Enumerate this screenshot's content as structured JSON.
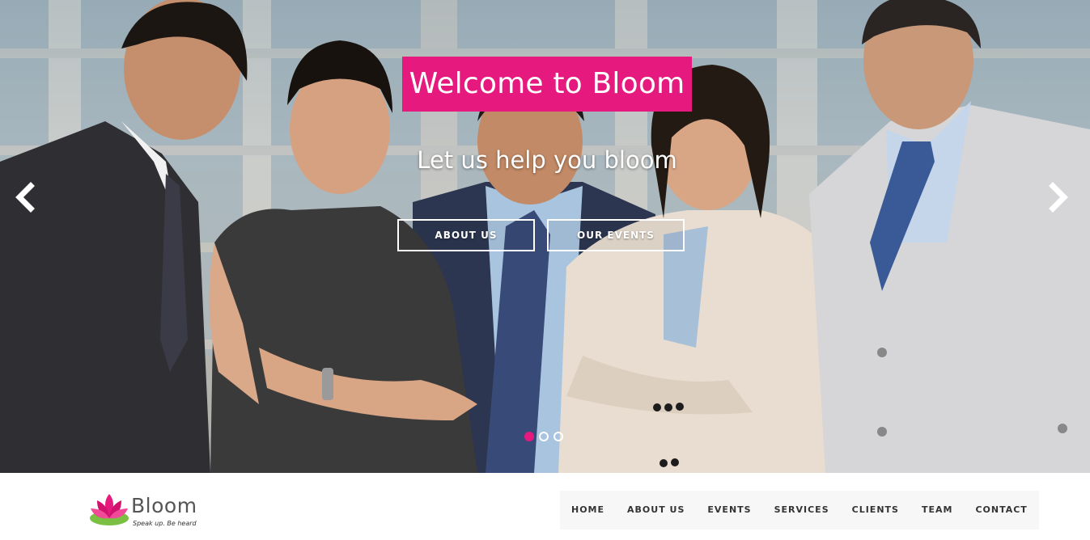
{
  "hero": {
    "title": "Welcome to Bloom",
    "subtitle": "Let us help you bloom",
    "buttons": [
      {
        "label": "ABOUT US"
      },
      {
        "label": "OUR EVENTS"
      }
    ],
    "slides": {
      "count": 3,
      "active": 1
    },
    "prev_icon": "chevron-left-icon",
    "next_icon": "chevron-right-icon",
    "accent_color": "#e6197f"
  },
  "brand": {
    "name": "Bloom",
    "tagline": "Speak up. Be heard",
    "logo_icon": "lotus-icon"
  },
  "nav": {
    "items": [
      {
        "label": "HOME"
      },
      {
        "label": "ABOUT US"
      },
      {
        "label": "EVENTS"
      },
      {
        "label": "SERVICES"
      },
      {
        "label": "CLIENTS"
      },
      {
        "label": "TEAM"
      },
      {
        "label": "CONTACT"
      }
    ]
  }
}
